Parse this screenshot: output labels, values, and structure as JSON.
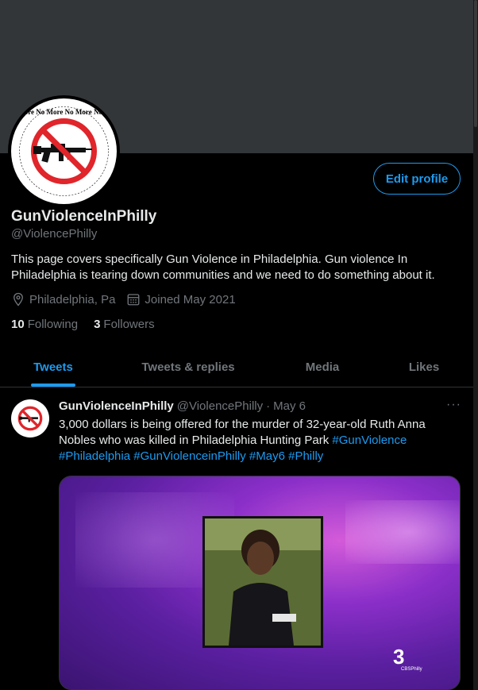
{
  "profile": {
    "name": "GunViolenceInPhilly",
    "handle": "@ViolencePhilly",
    "bio": "This page covers specifically Gun Violence in Philadelphia. Gun violence In Philadelphia is tearing down communities and we need to do something about it.",
    "location": "Philadelphia, Pa",
    "joined": "Joined May 2021",
    "following_count": "10",
    "following_label": "Following",
    "followers_count": "3",
    "followers_label": "Followers",
    "edit_label": "Edit profile",
    "avatar_text": "No More No More No More No More No More No More"
  },
  "tabs": [
    {
      "label": "Tweets",
      "active": true
    },
    {
      "label": "Tweets & replies",
      "active": false
    },
    {
      "label": "Media",
      "active": false
    },
    {
      "label": "Likes",
      "active": false
    }
  ],
  "tweet": {
    "name": "GunViolenceInPhilly",
    "handle": "@ViolencePhilly",
    "date": "May 6",
    "dot": "·",
    "more": "···",
    "text_plain": "3,000 dollars is being offered for the murder of 32-year-old Ruth Anna Nobles who was killed in Philadelphia Hunting Park",
    "hashtags": [
      "#GunViolence",
      "#Philadelphia",
      "#GunViolenceinPhilly",
      "#May6",
      "#Philly"
    ],
    "media_logo": "3",
    "media_logo_sub": "CBSPhilly"
  },
  "colors": {
    "accent": "#1d9bf0",
    "background": "#000000",
    "banner": "#333639",
    "muted": "#71767b"
  }
}
